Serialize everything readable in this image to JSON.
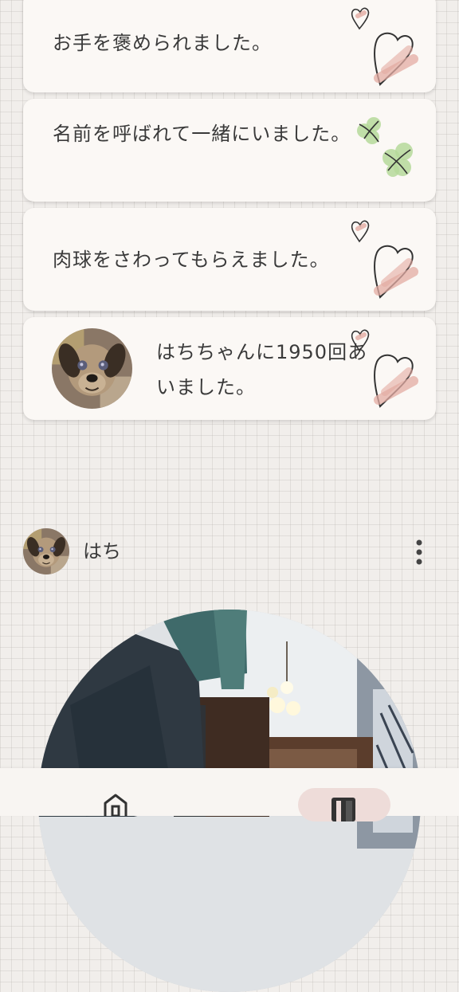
{
  "cards": [
    {
      "text": "お手を褒められました。",
      "decoration": "heart-icon"
    },
    {
      "text": "名前を呼ばれて一緒にいました。",
      "decoration": "clover-icon"
    },
    {
      "text": "肉球をさわってもらえました。",
      "decoration": "heart-icon"
    },
    {
      "text": "はちちゃんに1950回あいました。",
      "decoration": "heart-icon",
      "has_avatar": true
    }
  ],
  "profile": {
    "name": "はち"
  },
  "bottom_nav": {
    "items": [
      {
        "icon": "home-icon",
        "selected": false
      },
      {
        "icon": "diary-icon",
        "selected": true
      }
    ]
  },
  "colors": {
    "card_bg": "#fbf8f5",
    "heart_accent": "#e4aca3",
    "clover_accent": "#b5d99a",
    "nav_selected": "#eedcd9"
  }
}
